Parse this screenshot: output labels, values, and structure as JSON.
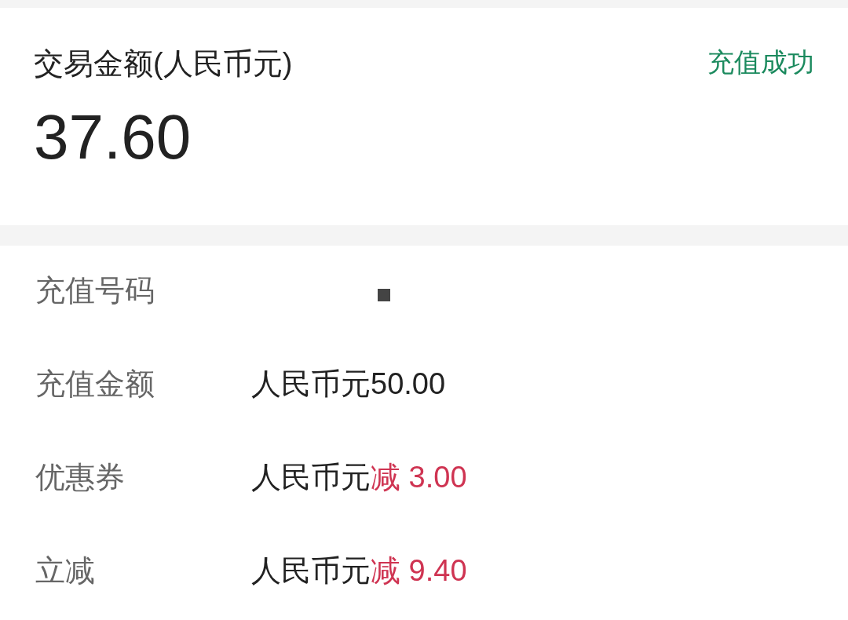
{
  "summary": {
    "title": "交易金额(人民币元)",
    "status": "充值成功",
    "amount": "37.60"
  },
  "details": [
    {
      "kind": "masked",
      "label": "充值号码"
    },
    {
      "kind": "amount",
      "label": "充值金额",
      "currency": "人民币元",
      "amount": "50.00",
      "discount": false
    },
    {
      "kind": "amount",
      "label": "优惠券",
      "currency": "人民币元",
      "amount": "减 3.00",
      "discount": true
    },
    {
      "kind": "amount",
      "label": "立减",
      "currency": "人民币元",
      "amount": "减 9.40",
      "discount": true
    }
  ]
}
